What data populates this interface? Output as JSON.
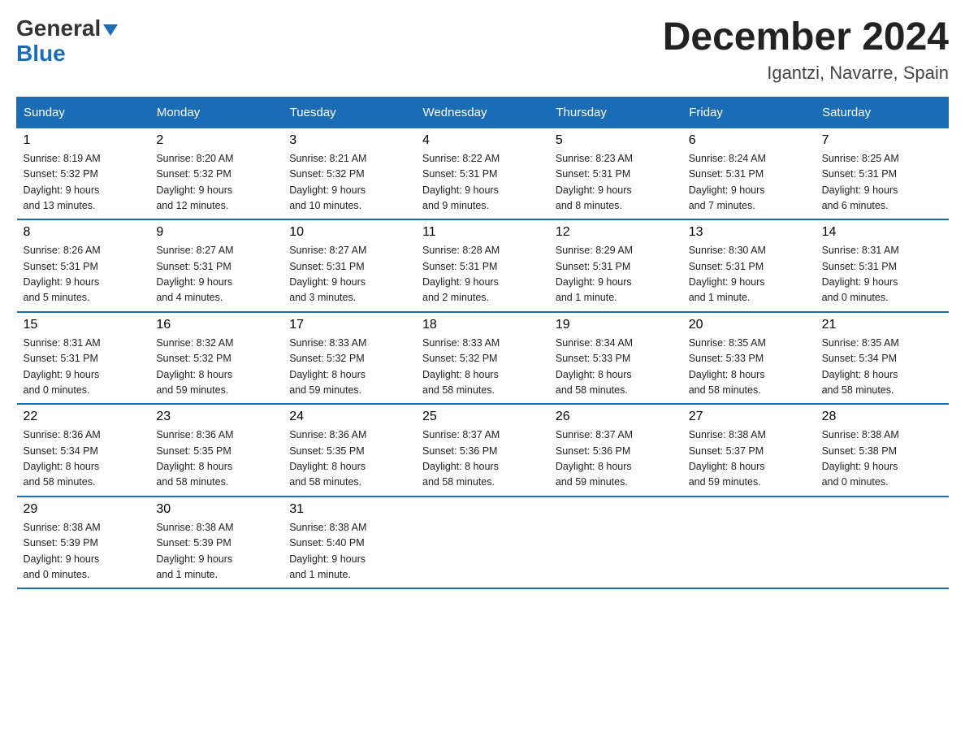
{
  "header": {
    "month_year": "December 2024",
    "location": "Igantzi, Navarre, Spain"
  },
  "weekdays": [
    "Sunday",
    "Monday",
    "Tuesday",
    "Wednesday",
    "Thursday",
    "Friday",
    "Saturday"
  ],
  "weeks": [
    [
      {
        "day": "1",
        "sunrise": "8:19 AM",
        "sunset": "5:32 PM",
        "daylight": "9 hours and 13 minutes."
      },
      {
        "day": "2",
        "sunrise": "8:20 AM",
        "sunset": "5:32 PM",
        "daylight": "9 hours and 12 minutes."
      },
      {
        "day": "3",
        "sunrise": "8:21 AM",
        "sunset": "5:32 PM",
        "daylight": "9 hours and 10 minutes."
      },
      {
        "day": "4",
        "sunrise": "8:22 AM",
        "sunset": "5:31 PM",
        "daylight": "9 hours and 9 minutes."
      },
      {
        "day": "5",
        "sunrise": "8:23 AM",
        "sunset": "5:31 PM",
        "daylight": "9 hours and 8 minutes."
      },
      {
        "day": "6",
        "sunrise": "8:24 AM",
        "sunset": "5:31 PM",
        "daylight": "9 hours and 7 minutes."
      },
      {
        "day": "7",
        "sunrise": "8:25 AM",
        "sunset": "5:31 PM",
        "daylight": "9 hours and 6 minutes."
      }
    ],
    [
      {
        "day": "8",
        "sunrise": "8:26 AM",
        "sunset": "5:31 PM",
        "daylight": "9 hours and 5 minutes."
      },
      {
        "day": "9",
        "sunrise": "8:27 AM",
        "sunset": "5:31 PM",
        "daylight": "9 hours and 4 minutes."
      },
      {
        "day": "10",
        "sunrise": "8:27 AM",
        "sunset": "5:31 PM",
        "daylight": "9 hours and 3 minutes."
      },
      {
        "day": "11",
        "sunrise": "8:28 AM",
        "sunset": "5:31 PM",
        "daylight": "9 hours and 2 minutes."
      },
      {
        "day": "12",
        "sunrise": "8:29 AM",
        "sunset": "5:31 PM",
        "daylight": "9 hours and 1 minute."
      },
      {
        "day": "13",
        "sunrise": "8:30 AM",
        "sunset": "5:31 PM",
        "daylight": "9 hours and 1 minute."
      },
      {
        "day": "14",
        "sunrise": "8:31 AM",
        "sunset": "5:31 PM",
        "daylight": "9 hours and 0 minutes."
      }
    ],
    [
      {
        "day": "15",
        "sunrise": "8:31 AM",
        "sunset": "5:31 PM",
        "daylight": "9 hours and 0 minutes."
      },
      {
        "day": "16",
        "sunrise": "8:32 AM",
        "sunset": "5:32 PM",
        "daylight": "8 hours and 59 minutes."
      },
      {
        "day": "17",
        "sunrise": "8:33 AM",
        "sunset": "5:32 PM",
        "daylight": "8 hours and 59 minutes."
      },
      {
        "day": "18",
        "sunrise": "8:33 AM",
        "sunset": "5:32 PM",
        "daylight": "8 hours and 58 minutes."
      },
      {
        "day": "19",
        "sunrise": "8:34 AM",
        "sunset": "5:33 PM",
        "daylight": "8 hours and 58 minutes."
      },
      {
        "day": "20",
        "sunrise": "8:35 AM",
        "sunset": "5:33 PM",
        "daylight": "8 hours and 58 minutes."
      },
      {
        "day": "21",
        "sunrise": "8:35 AM",
        "sunset": "5:34 PM",
        "daylight": "8 hours and 58 minutes."
      }
    ],
    [
      {
        "day": "22",
        "sunrise": "8:36 AM",
        "sunset": "5:34 PM",
        "daylight": "8 hours and 58 minutes."
      },
      {
        "day": "23",
        "sunrise": "8:36 AM",
        "sunset": "5:35 PM",
        "daylight": "8 hours and 58 minutes."
      },
      {
        "day": "24",
        "sunrise": "8:36 AM",
        "sunset": "5:35 PM",
        "daylight": "8 hours and 58 minutes."
      },
      {
        "day": "25",
        "sunrise": "8:37 AM",
        "sunset": "5:36 PM",
        "daylight": "8 hours and 58 minutes."
      },
      {
        "day": "26",
        "sunrise": "8:37 AM",
        "sunset": "5:36 PM",
        "daylight": "8 hours and 59 minutes."
      },
      {
        "day": "27",
        "sunrise": "8:38 AM",
        "sunset": "5:37 PM",
        "daylight": "8 hours and 59 minutes."
      },
      {
        "day": "28",
        "sunrise": "8:38 AM",
        "sunset": "5:38 PM",
        "daylight": "9 hours and 0 minutes."
      }
    ],
    [
      {
        "day": "29",
        "sunrise": "8:38 AM",
        "sunset": "5:39 PM",
        "daylight": "9 hours and 0 minutes."
      },
      {
        "day": "30",
        "sunrise": "8:38 AM",
        "sunset": "5:39 PM",
        "daylight": "9 hours and 1 minute."
      },
      {
        "day": "31",
        "sunrise": "8:38 AM",
        "sunset": "5:40 PM",
        "daylight": "9 hours and 1 minute."
      },
      null,
      null,
      null,
      null
    ]
  ]
}
